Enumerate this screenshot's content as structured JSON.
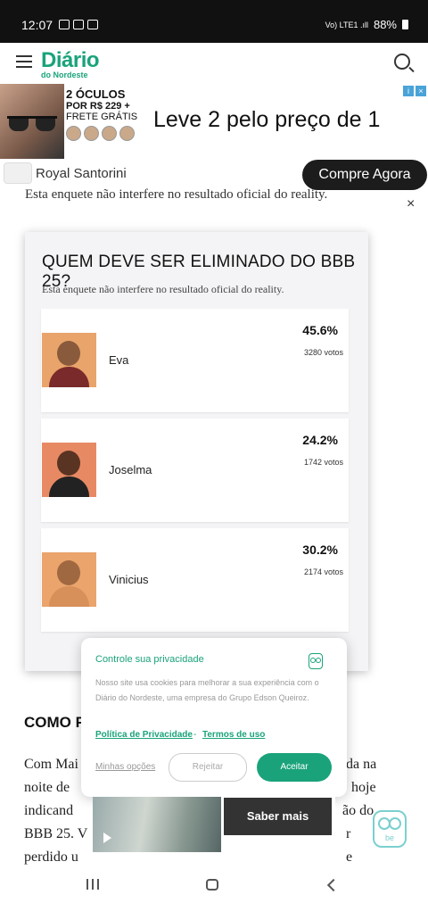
{
  "status_bar": {
    "time": "12:07",
    "network": "Vo) LTE1 .ıll",
    "battery": "88%"
  },
  "header": {
    "logo_main": "Diário",
    "logo_sub": "do Nordeste"
  },
  "ad": {
    "promo_line1": "2 ÓCULOS",
    "promo_line2": "POR R$ 229 +",
    "promo_line3": "FRETE GRÁTIS",
    "headline": "Leve 2 pelo preço de 1",
    "brand": "Royal Santorini",
    "cta": "Compre Agora"
  },
  "behind_text": "Esta enquete não interfere no resultado oficial do reality.",
  "poll": {
    "title": "QUEM DEVE SER ELIMINADO DO BBB 25?",
    "subtitle": "Esta enquete não interfere no resultado oficial do reality.",
    "options": [
      {
        "name": "Eva",
        "percent": "45.6%",
        "votes": "3280 votos",
        "photo_bg": "#e8a46a",
        "skin": "#8a5a3c",
        "shirt": "#7a2a2a"
      },
      {
        "name": "Joselma",
        "percent": "24.2%",
        "votes": "1742 votos",
        "photo_bg": "#e78a64",
        "skin": "#5a3422",
        "shirt": "#222"
      },
      {
        "name": "Vinicius",
        "percent": "30.2%",
        "votes": "2174 votos",
        "photo_bg": "#eaa46c",
        "skin": "#a06840",
        "shirt": "#d8905a"
      }
    ]
  },
  "article": {
    "heading": "COMO F",
    "lines_left": [
      "Com Mai",
      "noite de",
      "indicand",
      "BBB 25. V",
      "perdido u"
    ],
    "lines_right": [
      "da na",
      "hoje",
      "ão do",
      "r",
      "e"
    ]
  },
  "cookie": {
    "title": "Controle sua privacidade",
    "text": "Nosso site usa cookies para melhorar a sua experiência com o Diário do Nordeste, uma empresa do Grupo Edson Queiroz.",
    "privacy_link": "Política de Privacidade",
    "separator": "-",
    "terms_link": "Termos de uso",
    "my_options": "Minhas opções",
    "reject": "Rejeitar",
    "accept": "Aceitar"
  },
  "bottom_ad": {
    "cta": "Saber mais"
  },
  "be_badge": "be",
  "icons": [
    "menu-icon",
    "search-icon",
    "ad-choices-icon",
    "close-icon",
    "privacy-owl-icon",
    "play-icon",
    "be-owl-icon",
    "nav-recent-icon",
    "nav-home-icon",
    "nav-back-icon"
  ],
  "colors": {
    "brand_green": "#1aa37a",
    "ad_cta_bg": "#1c1c1c",
    "status_bar": "#111111"
  }
}
